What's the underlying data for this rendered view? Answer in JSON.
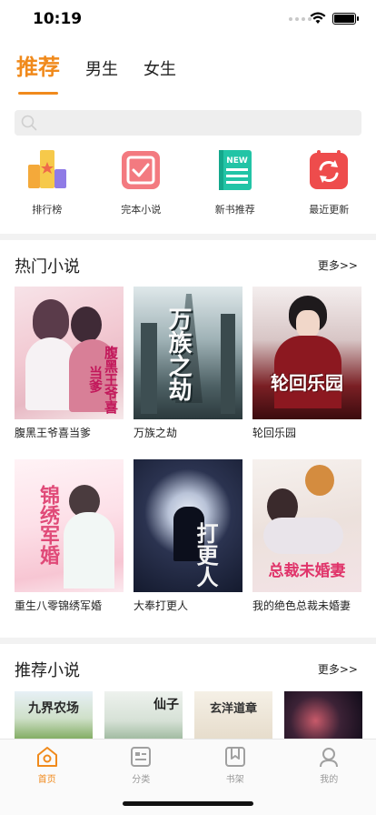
{
  "status": {
    "time": "10:19",
    "battery_level": 1.0
  },
  "tabs": [
    {
      "label": "推荐",
      "active": true
    },
    {
      "label": "男生",
      "active": false
    },
    {
      "label": "女生",
      "active": false
    }
  ],
  "search": {
    "placeholder": ""
  },
  "quick_links": [
    {
      "label": "排行榜",
      "icon": "ranking-icon"
    },
    {
      "label": "完本小说",
      "icon": "completed-check-icon"
    },
    {
      "label": "新书推荐",
      "icon": "new-book-icon"
    },
    {
      "label": "最近更新",
      "icon": "refresh-icon"
    }
  ],
  "hot_section": {
    "title": "热门小说",
    "more": "更多>>",
    "books": [
      {
        "title": "腹黑王爷喜当爹",
        "cover_text": "腹黑王爷喜当爹"
      },
      {
        "title": "万族之劫",
        "cover_text": "万族之劫"
      },
      {
        "title": "轮回乐园",
        "cover_text": "轮回乐园"
      },
      {
        "title": "重生八零锦绣军婚",
        "cover_text": "锦绣军婚"
      },
      {
        "title": "大奉打更人",
        "cover_text": "打更人"
      },
      {
        "title": "我的绝色总裁未婚妻",
        "cover_text": "总裁未婚妻"
      }
    ]
  },
  "recommend_section": {
    "title": "推荐小说",
    "more": "更多>>",
    "covers": [
      {
        "cover_text": "九界农场"
      },
      {
        "cover_text": "仙子"
      },
      {
        "cover_text": "玄洋道章"
      },
      {
        "cover_text": ""
      }
    ]
  },
  "tabbar": [
    {
      "label": "首页",
      "icon": "home-icon",
      "active": true
    },
    {
      "label": "分类",
      "icon": "category-icon",
      "active": false
    },
    {
      "label": "书架",
      "icon": "bookshelf-icon",
      "active": false
    },
    {
      "label": "我的",
      "icon": "profile-icon",
      "active": false
    }
  ],
  "colors": {
    "accent": "#f08a1c",
    "text": "#222222",
    "muted": "#999999"
  }
}
